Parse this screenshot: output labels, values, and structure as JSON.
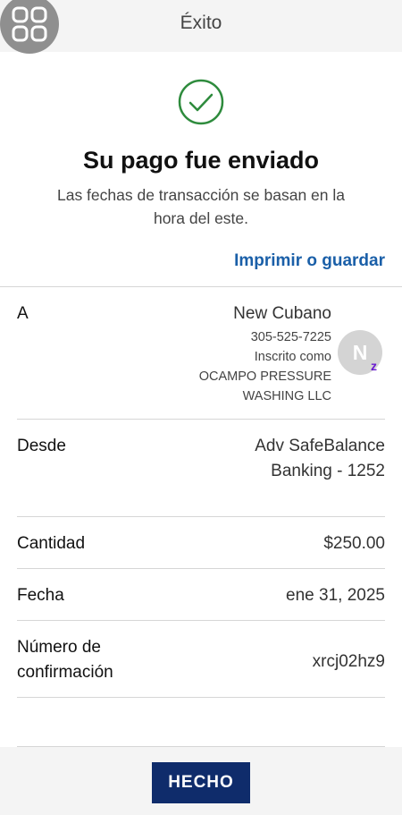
{
  "header": {
    "title": "Éxito",
    "apps_icon": "grid-apps-icon"
  },
  "status": {
    "icon": "check-circle-icon",
    "success_color": "#2e8b3d",
    "headline": "Su pago fue enviado",
    "subtitle_line1": "Las fechas de transacción se basan en la",
    "subtitle_line2": "hora del este."
  },
  "actions": {
    "print_label": "Imprimir o guardar",
    "done_label": "HECHO"
  },
  "details": {
    "to": {
      "label": "A",
      "name": "New Cubano",
      "phone": "305-525-7225",
      "enrolled_as": "Inscrito como",
      "business_line1": "OCAMPO PRESSURE",
      "business_line2": "WASHING LLC",
      "avatar_initial": "N",
      "zelle_badge": "z"
    },
    "from": {
      "label": "Desde",
      "value_line1": "Adv SafeBalance",
      "value_line2": "Banking - 1252"
    },
    "amount": {
      "label": "Cantidad",
      "value": "$250.00"
    },
    "date": {
      "label": "Fecha",
      "value": "ene 31, 2025"
    },
    "confirmation": {
      "label_line1": "Número de",
      "label_line2": "confirmación",
      "value": "xrcj02hz9"
    }
  },
  "colors": {
    "link": "#1a5fa8",
    "button": "#0f2c6b",
    "zelle": "#6b1cd1"
  }
}
